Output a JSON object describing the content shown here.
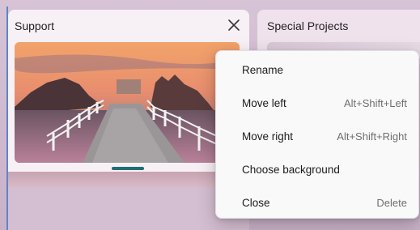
{
  "cards": [
    {
      "title": "Support"
    },
    {
      "title": "Special Projects"
    }
  ],
  "context_menu": {
    "items": [
      {
        "label": "Rename",
        "shortcut": ""
      },
      {
        "label": "Move left",
        "shortcut": "Alt+Shift+Left"
      },
      {
        "label": "Move right",
        "shortcut": "Alt+Shift+Right"
      },
      {
        "label": "Choose background",
        "shortcut": ""
      },
      {
        "label": "Close",
        "shortcut": "Delete"
      }
    ]
  },
  "icons": {
    "close": "close-icon"
  },
  "colors": {
    "accent": "#1e6e72",
    "frame": "#5f84c8"
  }
}
